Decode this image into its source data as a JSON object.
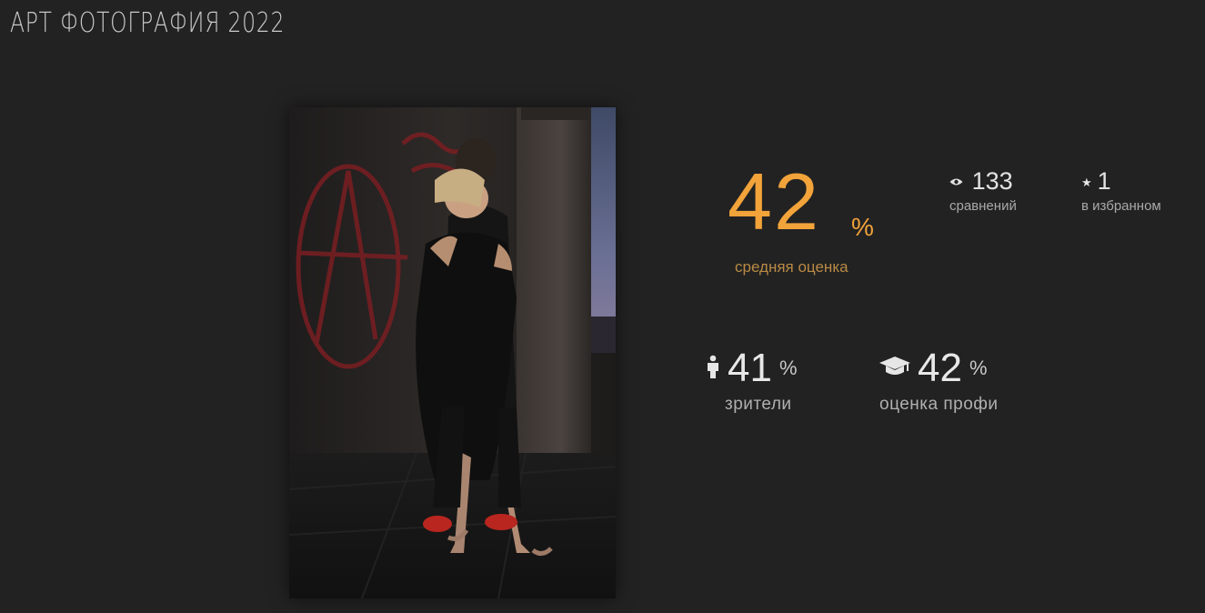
{
  "page": {
    "title": "АРТ ФОТОГРАФИЯ 2022"
  },
  "stats": {
    "average": {
      "value": "42",
      "unit": "%",
      "label": "средняя оценка"
    },
    "comparisons": {
      "value": "133",
      "label": "сравнений",
      "icon": "eye-icon"
    },
    "favorites": {
      "value": "1",
      "label": "в избранном",
      "icon": "star-icon"
    },
    "viewers": {
      "value": "41",
      "unit": "%",
      "label": "зрители",
      "icon": "person-icon"
    },
    "pros": {
      "value": "42",
      "unit": "%",
      "label": "оценка профи",
      "icon": "graduation-cap-icon"
    }
  },
  "colors": {
    "accent": "#f2a33a",
    "background": "#222222"
  }
}
